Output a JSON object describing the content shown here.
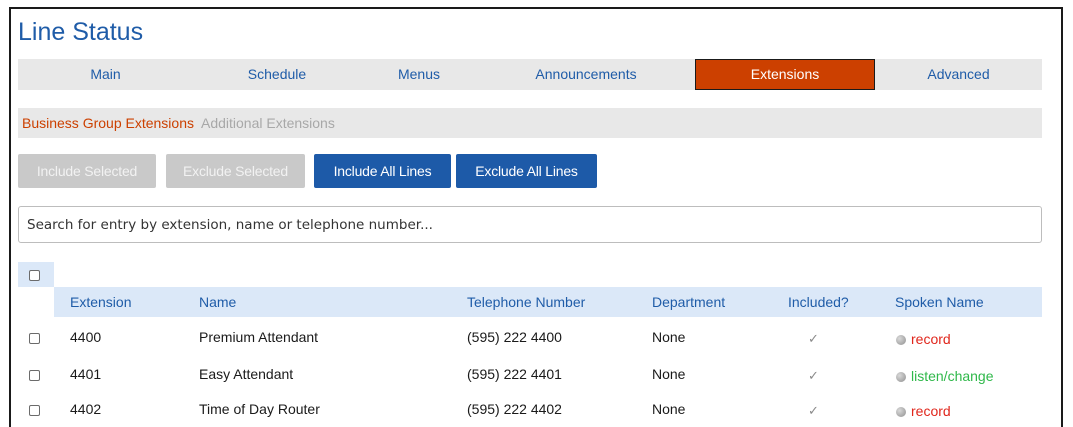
{
  "page": {
    "title": "Line Status"
  },
  "tabs": [
    {
      "label": "Main",
      "active": false
    },
    {
      "label": "Schedule",
      "active": false
    },
    {
      "label": "Menus",
      "active": false
    },
    {
      "label": "Announcements",
      "active": false
    },
    {
      "label": "Extensions",
      "active": true
    },
    {
      "label": "Advanced",
      "active": false
    }
  ],
  "subnav": {
    "active": "Business Group Extensions",
    "inactive": "Additional Extensions"
  },
  "buttons": {
    "include_selected": "Include Selected",
    "exclude_selected": "Exclude Selected",
    "include_all": "Include All Lines",
    "exclude_all": "Exclude All Lines"
  },
  "search": {
    "placeholder": "Search for entry by extension, name or telephone number...",
    "value": ""
  },
  "table": {
    "headers": {
      "extension": "Extension",
      "name": "Name",
      "telephone": "Telephone Number",
      "department": "Department",
      "included": "Included?",
      "spoken": "Spoken Name"
    },
    "rows": [
      {
        "extension": "4400",
        "name": "Premium Attendant",
        "telephone": "(595) 222 4400",
        "department": "None",
        "included": "✓",
        "spoken": "record",
        "spoken_color": "#e0261c"
      },
      {
        "extension": "4401",
        "name": "Easy Attendant",
        "telephone": "(595) 222 4401",
        "department": "None",
        "included": "✓",
        "spoken": "listen/change",
        "spoken_color": "#2fb84a"
      },
      {
        "extension": "4402",
        "name": "Time of Day Router",
        "telephone": "(595) 222 4402",
        "department": "None",
        "included": "✓",
        "spoken": "record",
        "spoken_color": "#e0261c"
      }
    ]
  },
  "colors": {
    "accent": "#1f5ca8",
    "active_tab": "#cc4000",
    "button": "#1d5aa8",
    "header_bg": "#dbe8f8"
  }
}
